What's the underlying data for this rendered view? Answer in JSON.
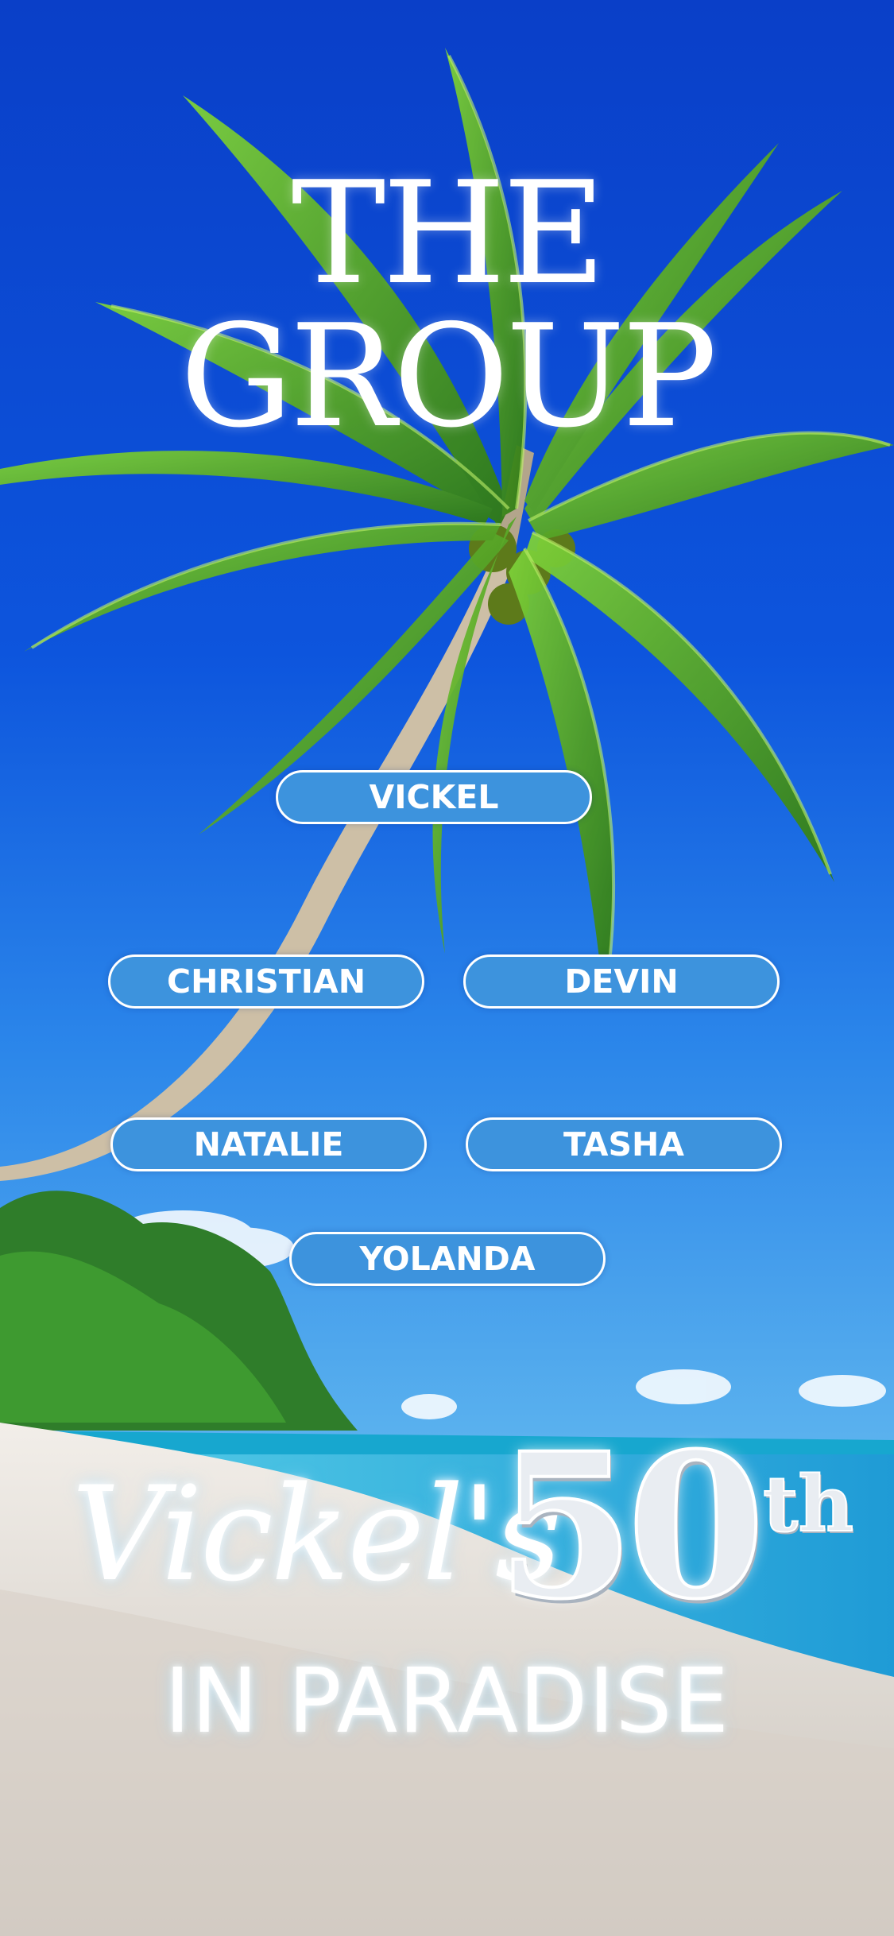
{
  "header": {
    "title_line1": "THE",
    "title_line2": "GROUP"
  },
  "members": [
    "VICKEL",
    "CHRISTIAN",
    "DEVIN",
    "NATALIE",
    "TASHA",
    "YOLANDA"
  ],
  "footer": {
    "script_name": "Vickel's",
    "number": "50",
    "ordinal": "th",
    "tagline": "IN PARADISE"
  },
  "colors": {
    "sky": "#0a3fc8",
    "pill_fill": "#3d93dd",
    "pill_border": "#ffffff",
    "text": "#ffffff",
    "ocean": "#3cc2e6",
    "sand": "#e8e1d8",
    "palm_leaf": "#4ea21e"
  }
}
